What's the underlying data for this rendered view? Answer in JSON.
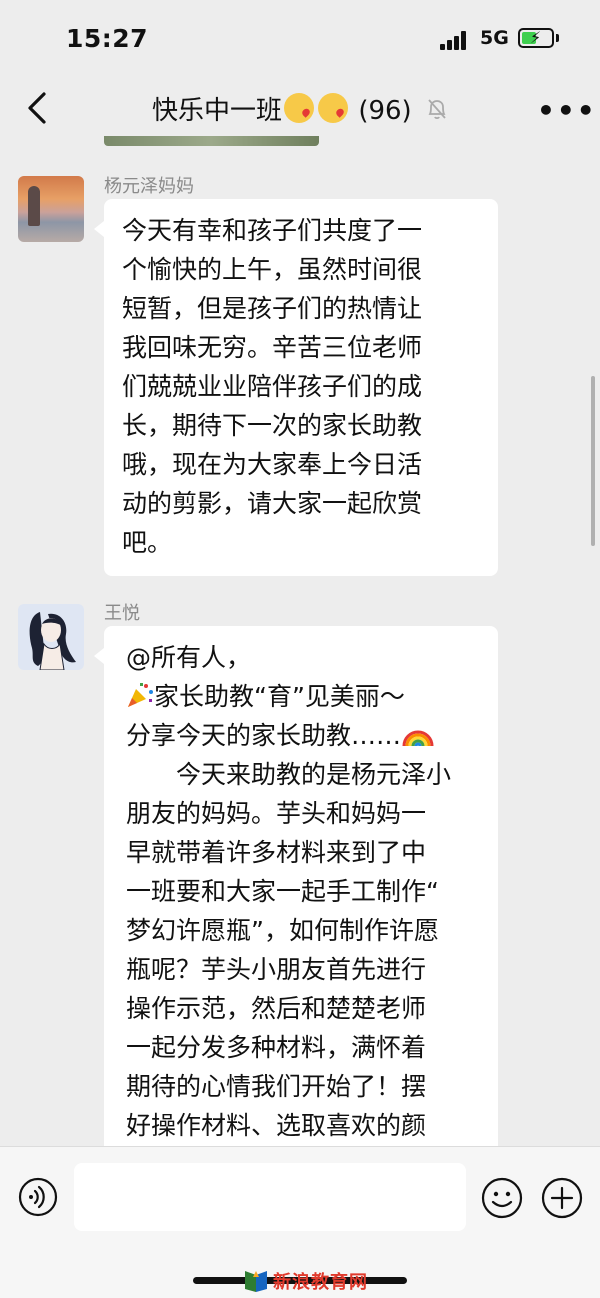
{
  "status_bar": {
    "time": "15:27",
    "network": "5G",
    "battery_level": 0.4
  },
  "nav": {
    "title": "快乐中一班",
    "member_count": "(96)",
    "back_icon": "chevron-left-icon",
    "mute_icon": "bell-slash-icon",
    "more_icon": "ellipsis-icon"
  },
  "messages": [
    {
      "sender": "杨元泽妈妈",
      "lines": [
        "今天有幸和孩子们共度了一",
        "个愉快的上午，虽然时间很",
        "短暂，但是孩子们的热情让",
        "我回味无穷。辛苦三位老师",
        "们兢兢业业陪伴孩子们的成",
        "长，期待下一次的家长助教",
        "哦，现在为大家奉上今日活",
        "动的剪影，请大家一起欣赏",
        "吧。"
      ]
    },
    {
      "sender": "王悦",
      "mention": "@所有人，",
      "headline": "家长助教“育”见美丽～",
      "subline": "分享今天的家长助教……",
      "lines": [
        "　　今天来助教的是杨元泽小",
        "朋友的妈妈。芋头和妈妈一",
        "早就带着许多材料来到了中",
        "一班要和大家一起手工制作“",
        "梦幻许愿瓶”，如何制作许愿",
        "瓶呢？芋头小朋友首先进行",
        "操作示范，然后和楚楚老师",
        "一起分发多种材料，满怀着",
        "期待的心情我们开始了！摆",
        "好操作材料、选取喜欢的颜"
      ]
    }
  ],
  "input_bar": {
    "placeholder": "",
    "voice_icon": "voice-icon",
    "emoji_icon": "smiley-icon",
    "plus_icon": "plus-circle-icon"
  },
  "watermark": {
    "text": "新浪教育网"
  },
  "colors": {
    "background": "#ededed",
    "bubble": "#ffffff",
    "sender_name": "#8a8a8a",
    "watermark": "#e03a2c"
  }
}
